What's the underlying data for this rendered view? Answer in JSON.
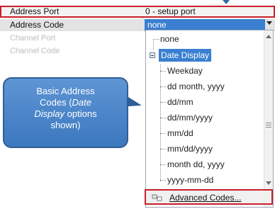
{
  "property_grid": {
    "rows": [
      {
        "name": "Address Port",
        "value": "0 - setup port"
      },
      {
        "name": "Address Code",
        "value": "none"
      },
      {
        "name": "Channel Port",
        "value": ""
      },
      {
        "name": "Channel Code",
        "value": ""
      }
    ]
  },
  "dropdown": {
    "items": [
      {
        "label": "none",
        "level": 0
      },
      {
        "label": "Date Display",
        "level": 0,
        "selected": true,
        "expanded": true
      },
      {
        "label": "Weekday",
        "level": 1
      },
      {
        "label": "dd month, yyyy",
        "level": 1
      },
      {
        "label": "dd/mm",
        "level": 1
      },
      {
        "label": "dd/mm/yyyy",
        "level": 1
      },
      {
        "label": "mm/dd",
        "level": 1
      },
      {
        "label": "mm/dd/yyyy",
        "level": 1
      },
      {
        "label": "month dd, yyyy",
        "level": 1
      },
      {
        "label": "yyyy-mm-dd",
        "level": 1
      }
    ],
    "button_label": "Advanced Codes..."
  },
  "callout": {
    "line1": "Basic Address",
    "line2_a": "Codes (",
    "line2_em": "Date",
    "line3_em": "Display",
    "line3_b": " options",
    "line4": "shown)"
  },
  "colors": {
    "selection": "#3a7fd1",
    "highlight_border": "#c9202a",
    "callout_fill": "#4a86c8"
  }
}
